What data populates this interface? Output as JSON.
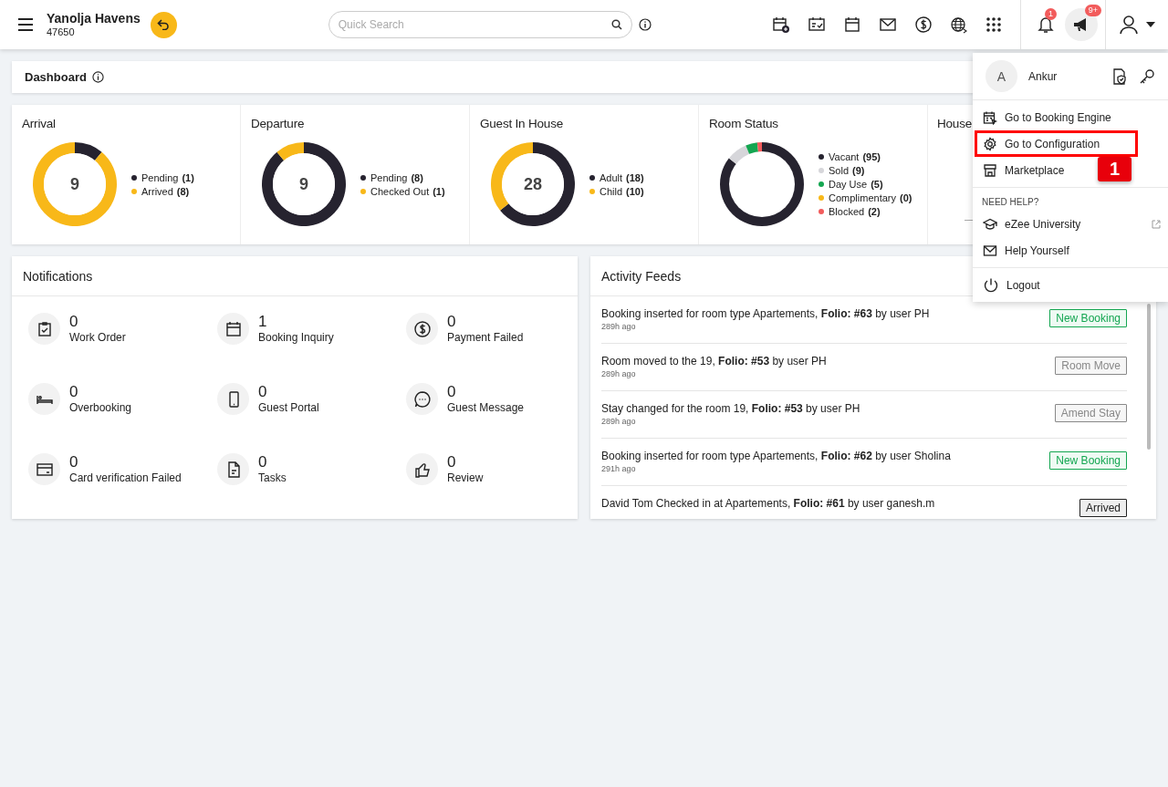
{
  "header": {
    "property_name": "Yanolja Havens",
    "property_code": "47650",
    "search": {
      "placeholder": "Quick Search"
    },
    "notification_count": "1",
    "announcement_count": "9+"
  },
  "page_title": "Dashboard",
  "stats": [
    {
      "center": "9",
      "legend": [
        {
          "color": "#26232f"
        },
        {
          "color": "#f8b819"
        }
      ],
      "chart_data": {
        "type": "donut",
        "legend": "right",
        "title": "Arrival",
        "categories": [
          "Pending",
          "Arrived"
        ],
        "values": [
          1,
          8
        ],
        "value_labels": [
          "(1)",
          "(8)"
        ]
      }
    },
    {
      "center": "9",
      "legend": [
        {
          "color": "#26232f"
        },
        {
          "color": "#f8b819"
        }
      ],
      "chart_data": {
        "type": "donut",
        "legend": "right",
        "title": "Departure",
        "categories": [
          "Pending",
          "Checked Out"
        ],
        "values": [
          8,
          1
        ],
        "value_labels": [
          "(8)",
          "(1)"
        ]
      }
    },
    {
      "center": "28",
      "legend": [
        {
          "color": "#26232f"
        },
        {
          "color": "#f8b819"
        }
      ],
      "chart_data": {
        "type": "donut",
        "legend": "right",
        "title": "Guest In House",
        "categories": [
          "Adult",
          "Child"
        ],
        "values": [
          18,
          10
        ],
        "value_labels": [
          "(18)",
          "(10)"
        ]
      }
    },
    {
      "legend": [
        {
          "color": "#26232f"
        },
        {
          "color": "#d6d6da"
        },
        {
          "color": "#14a651"
        },
        {
          "color": "#f8b819"
        },
        {
          "color": "#f25c5c"
        }
      ],
      "chart_data": {
        "type": "donut",
        "legend": "right",
        "title": "Room Status",
        "categories": [
          "Vacant",
          "Sold",
          "Day Use",
          "Complimentary",
          "Blocked"
        ],
        "values": [
          95,
          9,
          5,
          0,
          2
        ],
        "value_labels": [
          "(95)",
          "(9)",
          "(5)",
          "(0)",
          "(2)"
        ]
      }
    },
    {
      "title": "House"
    }
  ],
  "notifications": {
    "title": "Notifications",
    "items": [
      {
        "count": "0",
        "label": "Work Order"
      },
      {
        "count": "1",
        "label": "Booking Inquiry"
      },
      {
        "count": "0",
        "label": "Payment Failed"
      },
      {
        "count": "0",
        "label": "Overbooking"
      },
      {
        "count": "0",
        "label": "Guest Portal"
      },
      {
        "count": "0",
        "label": "Guest Message"
      },
      {
        "count": "0",
        "label": "Card verification Failed"
      },
      {
        "count": "0",
        "label": "Tasks"
      },
      {
        "count": "0",
        "label": "Review"
      }
    ]
  },
  "activity": {
    "title": "Activity Feeds",
    "items": [
      {
        "text": "Booking inserted for room type Apartements, **Folio: #63** by user PH",
        "time": "289h ago",
        "tag": "New Booking",
        "kind": "new"
      },
      {
        "text": "Room moved to the 19, **Folio: #53** by user PH",
        "time": "289h ago",
        "tag": "Room Move",
        "kind": "neutral"
      },
      {
        "text": "Stay changed for the room 19, **Folio: #53** by user PH",
        "time": "289h ago",
        "tag": "Amend Stay",
        "kind": "neutral"
      },
      {
        "text": "Booking inserted for room type Apartements, **Folio: #62** by user Sholina",
        "time": "291h ago",
        "tag": "New Booking",
        "kind": "new"
      },
      {
        "text": "David Tom Checked in at Apartements, **Folio: #61** by user ganesh.m",
        "tag": "Arrived",
        "kind": "arrived"
      }
    ]
  },
  "user_menu": {
    "initial": "A",
    "name": "Ankur",
    "items": [
      {
        "label": "Go to Booking Engine",
        "highlighted": false
      },
      {
        "label": "Go to Configuration",
        "highlighted": true
      },
      {
        "label": "Marketplace",
        "highlighted": false
      }
    ],
    "help_heading": "NEED HELP?",
    "help_items": [
      {
        "label": "eZee University",
        "external": true
      },
      {
        "label": "Help Yourself",
        "external": false
      }
    ],
    "logout": "Logout"
  },
  "callout": "1"
}
